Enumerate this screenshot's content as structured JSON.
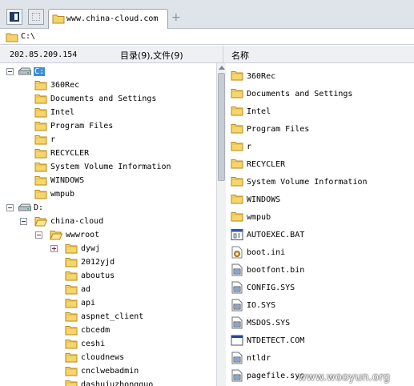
{
  "tabbar": {
    "tab_title": "www.china-cloud.com",
    "add_tab": "+"
  },
  "address": {
    "path": "C:\\"
  },
  "header": {
    "ip": "202.85.209.154",
    "count": "目录(9),文件(9)",
    "column_name": "名称"
  },
  "tree": {
    "c_drive": "C:",
    "c_children": [
      "360Rec",
      "Documents and Settings",
      "Intel",
      "Program Files",
      "r",
      "RECYCLER",
      "System Volume Information",
      "WINDOWS",
      "wmpub"
    ],
    "d_drive": "D:",
    "china_cloud": "china-cloud",
    "wwwroot": "wwwroot",
    "dywj": "dywj",
    "wwwroot_children": [
      "2012yjd",
      "aboutus",
      "ad",
      "api",
      "aspnet_client",
      "cbcedm",
      "ceshi",
      "cloudnews",
      "cnclwebadmin",
      "dashujuzhongguo"
    ]
  },
  "list": {
    "folders": [
      "360Rec",
      "Documents and Settings",
      "Intel",
      "Program Files",
      "r",
      "RECYCLER",
      "System Volume Information",
      "WINDOWS",
      "wmpub"
    ],
    "files": [
      {
        "name": "AUTOEXEC.BAT",
        "icon": "batch-file-icon"
      },
      {
        "name": "boot.ini",
        "icon": "ini-file-icon"
      },
      {
        "name": "bootfont.bin",
        "icon": "system-file-icon"
      },
      {
        "name": "CONFIG.SYS",
        "icon": "system-file-icon"
      },
      {
        "name": "IO.SYS",
        "icon": "system-file-icon"
      },
      {
        "name": "MSDOS.SYS",
        "icon": "system-file-icon"
      },
      {
        "name": "NTDETECT.COM",
        "icon": "application-file-icon"
      },
      {
        "name": "ntldr",
        "icon": "system-file-icon"
      },
      {
        "name": "pagefile.sys",
        "icon": "system-file-icon"
      }
    ]
  },
  "watermark": "www.wooyun.org"
}
